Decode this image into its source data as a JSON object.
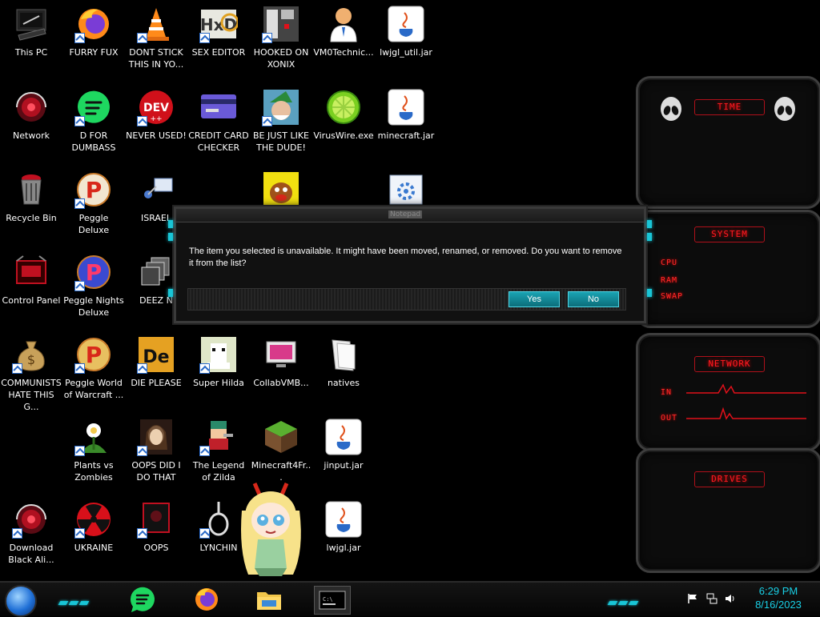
{
  "desktop": {
    "icons": [
      {
        "label": "This PC",
        "x": 0,
        "y": 0
      },
      {
        "label": "FURRY FUX"
      },
      {
        "label": "DONT STICK THIS IN YO..."
      },
      {
        "label": "SEX EDITOR"
      },
      {
        "label": "HOOKED ON XONIX"
      },
      {
        "label": "VM0Technic..."
      },
      {
        "label": "lwjgl_util.jar"
      },
      {
        "label": "Network"
      },
      {
        "label": "D FOR DUMBASS"
      },
      {
        "label": "NEVER USED!"
      },
      {
        "label": "CREDIT CARD CHECKER"
      },
      {
        "label": "BE JUST LIKE THE DUDE!"
      },
      {
        "label": "VirusWire.exe"
      },
      {
        "label": "minecraft.jar"
      },
      {
        "label": "Recycle Bin"
      },
      {
        "label": "Peggle Deluxe"
      },
      {
        "label": "ISRAEL"
      },
      {
        "label": "Control Panel"
      },
      {
        "label": "Peggle Nights Deluxe"
      },
      {
        "label": "DEEZ N"
      },
      {
        "label": "COMMUNISTS HATE THIS G..."
      },
      {
        "label": "Peggle World of Warcraft ..."
      },
      {
        "label": "DIE PLEASE"
      },
      {
        "label": "Super Hilda"
      },
      {
        "label": "CollabVMB..."
      },
      {
        "label": "natives"
      },
      {
        "label": "Plants vs Zombies"
      },
      {
        "label": "OOPS DID I DO THAT"
      },
      {
        "label": "The Legend of Zilda"
      },
      {
        "label": "Minecraft4Fr..."
      },
      {
        "label": "jinput.jar"
      },
      {
        "label": "Download Black Ali..."
      },
      {
        "label": "UKRAINE"
      },
      {
        "label": "OOPS"
      },
      {
        "label": "LYNCHIN"
      },
      {
        "label": "lwjgl.jar"
      }
    ]
  },
  "dialog": {
    "title": "Notepad",
    "message": "The item you selected is unavailable.  It might have been moved, renamed, or removed.  Do you want to remove it from the list?",
    "yes_label": "Yes",
    "no_label": "No"
  },
  "widgets": {
    "time": {
      "title": "TIME"
    },
    "system": {
      "title": "SYSTEM",
      "rows": [
        "CPU",
        "RAM",
        "SWAP"
      ]
    },
    "network": {
      "title": "NETWORK",
      "rows": [
        "IN",
        "OUT"
      ]
    },
    "drives": {
      "title": "DRIVES"
    }
  },
  "taskbar": {
    "time": "6:29 PM",
    "date": "8/16/2023",
    "accent": "#19c5d6"
  }
}
